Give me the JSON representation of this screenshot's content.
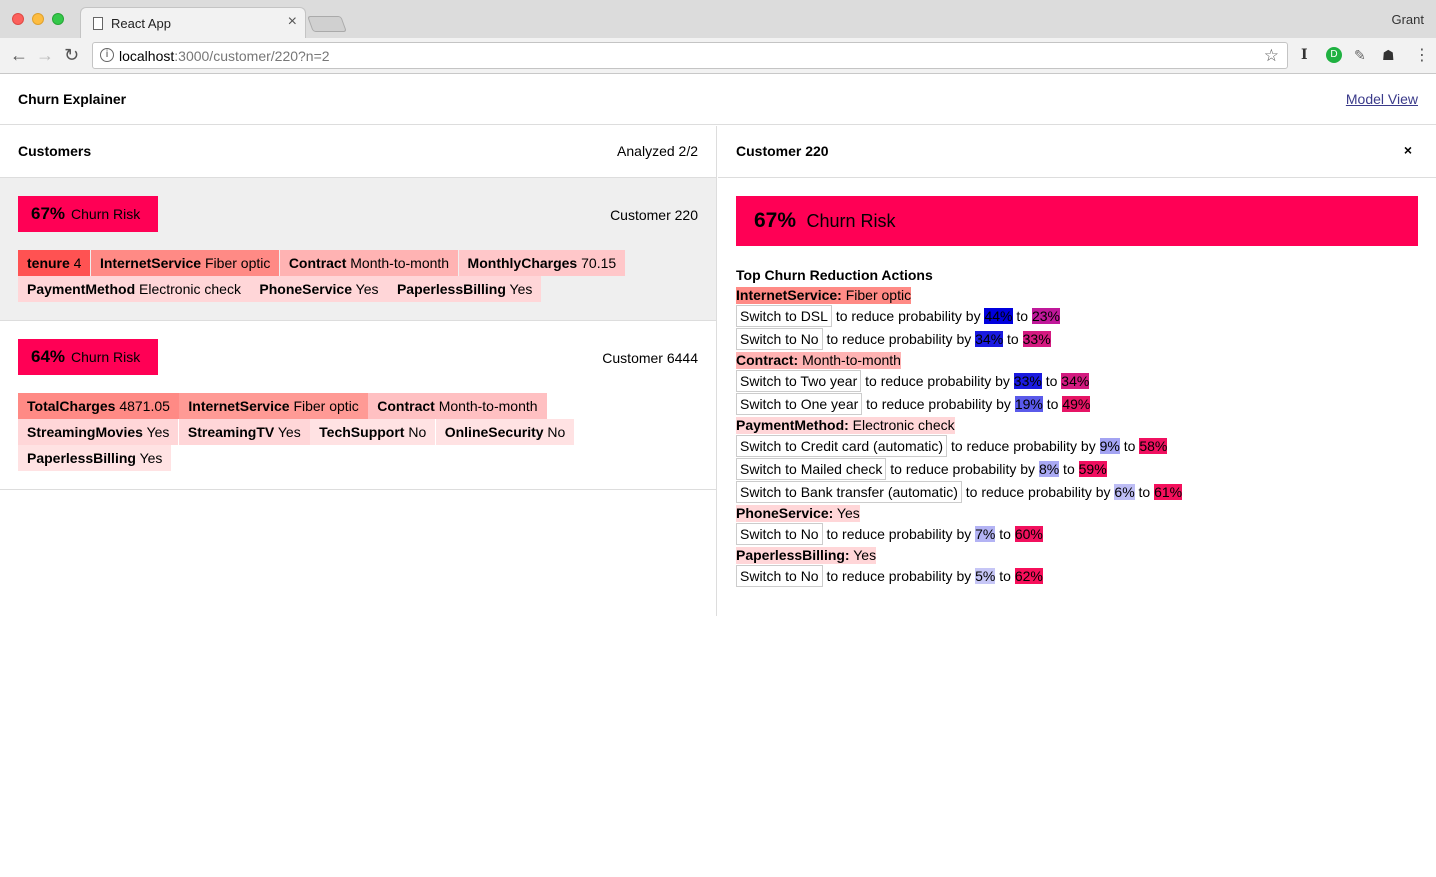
{
  "browser": {
    "tab_title": "React App",
    "tab_close": "×",
    "profile_name": "Grant",
    "url_host": "localhost",
    "url_path": ":3000/customer/220?n=2"
  },
  "app": {
    "title": "Churn Explainer",
    "model_view_link": "Model View"
  },
  "customers_pane": {
    "title": "Customers",
    "analyzed": "Analyzed 2/2",
    "customers": [
      {
        "risk_pct": "67%",
        "risk_label": "Churn Risk",
        "name": "Customer 220",
        "features": [
          {
            "name": "tenure",
            "value": "4",
            "color": "#ff5252"
          },
          {
            "name": "InternetService",
            "value": "Fiber optic",
            "color": "#ff8a85"
          },
          {
            "name": "Contract",
            "value": "Month-to-month",
            "color": "#ffb3b3"
          },
          {
            "name": "MonthlyCharges",
            "value": "70.15",
            "color": "#ffc7c9"
          },
          {
            "name": "PaymentMethod",
            "value": "Electronic check",
            "color": "#ffd6d8"
          },
          {
            "name": "PhoneService",
            "value": "Yes",
            "color": "#ffd6d8"
          },
          {
            "name": "PaperlessBilling",
            "value": "Yes",
            "color": "#ffd6d8"
          }
        ]
      },
      {
        "risk_pct": "64%",
        "risk_label": "Churn Risk",
        "name": "Customer 6444",
        "features": [
          {
            "name": "TotalCharges",
            "value": "4871.05",
            "color": "#ff8a85"
          },
          {
            "name": "InternetService",
            "value": "Fiber optic",
            "color": "#ff9a95"
          },
          {
            "name": "Contract",
            "value": "Month-to-month",
            "color": "#ffc0c2"
          },
          {
            "name": "StreamingMovies",
            "value": "Yes",
            "color": "#ffd6d8"
          },
          {
            "name": "StreamingTV",
            "value": "Yes",
            "color": "#ffd6d8"
          },
          {
            "name": "TechSupport",
            "value": "No",
            "color": "#ffe2e3"
          },
          {
            "name": "OnlineSecurity",
            "value": "No",
            "color": "#ffe2e3"
          },
          {
            "name": "PaperlessBilling",
            "value": "Yes",
            "color": "#ffe2e3"
          }
        ]
      }
    ]
  },
  "detail_pane": {
    "title": "Customer 220",
    "close_label": "×",
    "risk_pct": "67%",
    "risk_label": "Churn Risk",
    "actions_title": "Top Churn Reduction Actions",
    "reduce_text": "to reduce probability by",
    "to_text": "to",
    "groups": [
      {
        "feature": "InternetService:",
        "value": "Fiber optic",
        "head_color": "#ff8a85",
        "actions": [
          {
            "label": "Switch to DSL",
            "reduce": "44%",
            "reduce_color": "#0000dd",
            "result": "23%",
            "result_color": "#c0189a"
          },
          {
            "label": "Switch to No",
            "reduce": "34%",
            "reduce_color": "#1a1ae0",
            "result": "33%",
            "result_color": "#d41a80"
          }
        ]
      },
      {
        "feature": "Contract:",
        "value": "Month-to-month",
        "head_color": "#ffb3b3",
        "actions": [
          {
            "label": "Switch to Two year",
            "reduce": "33%",
            "reduce_color": "#1a1ae0",
            "result": "34%",
            "result_color": "#d41a80"
          },
          {
            "label": "Switch to One year",
            "reduce": "19%",
            "reduce_color": "#5a5aea",
            "result": "49%",
            "result_color": "#e61465"
          }
        ]
      },
      {
        "feature": "PaymentMethod:",
        "value": "Electronic check",
        "head_color": "#ffd6d8",
        "actions": [
          {
            "label": "Switch to Credit card (automatic)",
            "reduce": "9%",
            "reduce_color": "#a3a3f2",
            "result": "58%",
            "result_color": "#f01060"
          },
          {
            "label": "Switch to Mailed check",
            "reduce": "8%",
            "reduce_color": "#a9a9f3",
            "result": "59%",
            "result_color": "#f01060"
          },
          {
            "label": "Switch to Bank transfer (automatic)",
            "reduce": "6%",
            "reduce_color": "#bdbdf5",
            "result": "61%",
            "result_color": "#f4105c"
          }
        ]
      },
      {
        "feature": "PhoneService:",
        "value": "Yes",
        "head_color": "#ffd6d8",
        "actions": [
          {
            "label": "Switch to No",
            "reduce": "7%",
            "reduce_color": "#b3b3f4",
            "result": "60%",
            "result_color": "#f2105e"
          }
        ]
      },
      {
        "feature": "PaperlessBilling:",
        "value": "Yes",
        "head_color": "#ffd6d8",
        "actions": [
          {
            "label": "Switch to No",
            "reduce": "5%",
            "reduce_color": "#c6c6f6",
            "result": "62%",
            "result_color": "#f60f5a"
          }
        ]
      }
    ]
  }
}
